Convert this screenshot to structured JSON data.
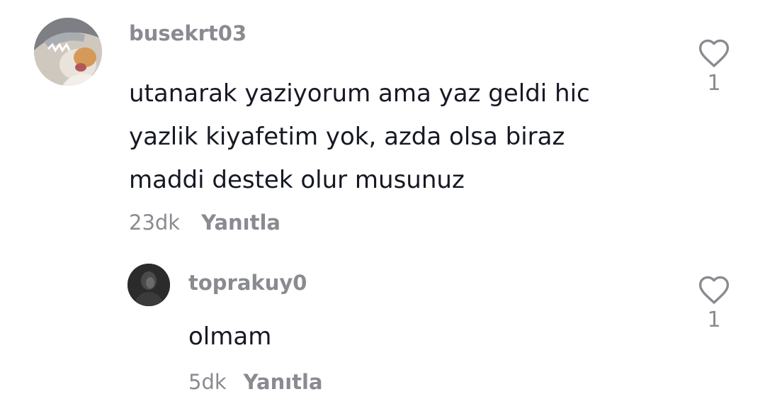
{
  "comments": [
    {
      "username": "busekrt03",
      "text_lines": [
        "utanarak yaziyorum ama yaz geldi hic",
        "yazlik kiyafetim yok, azda olsa biraz",
        "maddi destek olur musunuz"
      ],
      "time": "23dk",
      "reply_label": "Yanıtla",
      "like_count": "1"
    },
    {
      "username": "toprakuy0",
      "text_lines": [
        "olmam"
      ],
      "time": "5dk",
      "reply_label": "Yanıtla",
      "like_count": "1"
    }
  ],
  "icons": {
    "like": "heart-outline-icon"
  },
  "colors": {
    "username": "#8a8b91",
    "text": "#161823",
    "meta": "#8a8b91",
    "icon": "#8a8b91"
  }
}
